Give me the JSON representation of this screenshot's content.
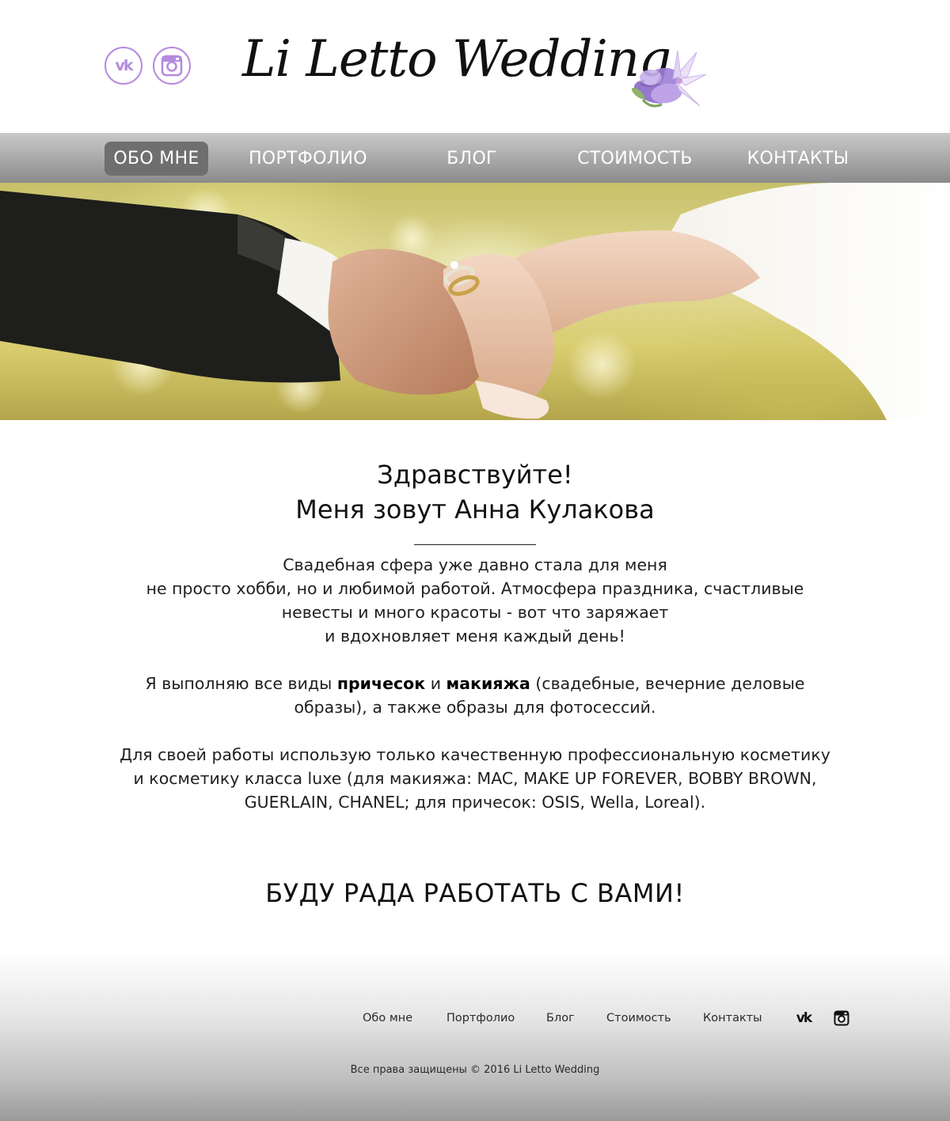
{
  "header": {
    "logo_text": "Li Letto Wedding",
    "social": [
      {
        "icon": "vk-icon",
        "label": "VK"
      },
      {
        "icon": "instagram-icon",
        "label": "Instagram"
      }
    ]
  },
  "nav": {
    "items": [
      {
        "label": "ОБО МНЕ",
        "active": true
      },
      {
        "label": "ПОРТФОЛИО",
        "active": false
      },
      {
        "label": "БЛОГ",
        "active": false
      },
      {
        "label": "СТОИМОСТЬ",
        "active": false
      },
      {
        "label": "КОНТАКТЫ",
        "active": false
      }
    ]
  },
  "hero": {
    "image_desc": "wedding-hands-with-rings"
  },
  "content": {
    "greeting_line1": "Здравствуйте!",
    "greeting_line2": "Меня зовут Анна Кулакова",
    "p1": [
      "Свадебная сфера уже давно стала для меня",
      "не просто хобби, но и любимой работой. Атмосфера праздника, счастливые",
      "невесты и много красоты - вот что заряжает",
      "и вдохновляет меня каждый день!"
    ],
    "p2_prefix": "Я выполняю все виды ",
    "p2_bold1": "причесок",
    "p2_mid": " и ",
    "p2_bold2": "макияжа",
    "p2_suffix": " (свадебные, вечерние деловые",
    "p2_line2": "образы), а также образы для фотосессий.",
    "p3": [
      "Для своей работы использую только качественную профессиональную косметику",
      "и косметику класса luxe (для макияжа: MAC, MAKE UP FOREVER, BOBBY BROWN,",
      "GUERLAIN, CHANEL; для причесок: OSIS, Wella, Loreal)."
    ],
    "closing": "БУДУ РАДА РАБОТАТЬ С ВАМИ!"
  },
  "footer": {
    "links": [
      "Обо мне",
      "Портфолио",
      "Блог",
      "Стоимость",
      "Контакты"
    ],
    "copyright": "Все права защищены © 2016 Li Letto Wedding"
  },
  "colors": {
    "accent_purple": "#b58be0",
    "nav_gradient_top": "#c9c9c9",
    "nav_gradient_bottom": "#8b8b8b",
    "nav_active": "#6f6f6f"
  }
}
